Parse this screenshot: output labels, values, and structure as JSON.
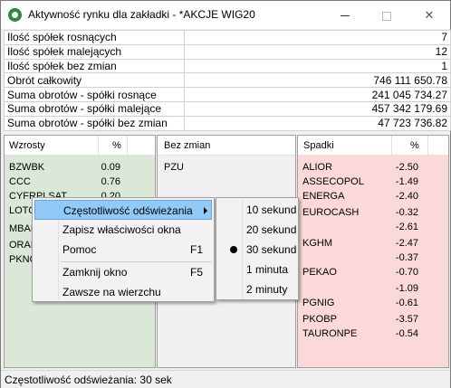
{
  "window": {
    "title": "Aktywność rynku dla zakładki - *AKCJE WIG20",
    "close_glyph": "✕"
  },
  "summary": [
    {
      "label": "Ilość spółek rosnących",
      "value": "7"
    },
    {
      "label": "Ilość spółek malejących",
      "value": "12"
    },
    {
      "label": "Ilość spółek bez zmian",
      "value": "1"
    },
    {
      "label": "Obrót całkowity",
      "value": "746 111 650.78"
    },
    {
      "label": "Suma obrotów - spółki rosnące",
      "value": "241 045 734.27"
    },
    {
      "label": "Suma obrotów - spółki malejące",
      "value": "457 342 179.69"
    },
    {
      "label": "Suma obrotów - spółki bez zmian",
      "value": "47 723 736.82"
    }
  ],
  "panels": {
    "up": {
      "title": "Wzrosty",
      "pct_header": "%",
      "rows": [
        {
          "name": "BZWBK",
          "pct": "0.09"
        },
        {
          "name": "CCC",
          "pct": "0.76"
        },
        {
          "name": "CYFRPLSAT",
          "pct": "0.20"
        },
        {
          "name": "LOTO",
          "pct": ""
        },
        {
          "name": "MBAN",
          "pct": ""
        },
        {
          "name": "ORAN",
          "pct": ""
        },
        {
          "name": "PKNO",
          "pct": ""
        }
      ]
    },
    "none": {
      "title": "Bez zmian",
      "rows": [
        {
          "name": "PZU"
        }
      ]
    },
    "down": {
      "title": "Spadki",
      "pct_header": "%",
      "rows": [
        {
          "name": "ALIOR",
          "pct": "-2.50"
        },
        {
          "name": "ASSECOPOL",
          "pct": "-1.49"
        },
        {
          "name": "ENERGA",
          "pct": "-2.40"
        },
        {
          "name": "EUROCASH",
          "pct": "-0.32"
        },
        {
          "name": "",
          "pct": "-2.61"
        },
        {
          "name": "KGHM",
          "pct": "-2.47"
        },
        {
          "name": "",
          "pct": "-0.37"
        },
        {
          "name": "PEKAO",
          "pct": "-0.70"
        },
        {
          "name": "",
          "pct": "-1.09"
        },
        {
          "name": "PGNIG",
          "pct": "-0.61"
        },
        {
          "name": "PKOBP",
          "pct": "-3.57"
        },
        {
          "name": "TAURONPE",
          "pct": "-0.54"
        }
      ]
    }
  },
  "context_menu": {
    "items": [
      {
        "label": "Częstotliwość odświeżania",
        "shortcut": "",
        "has_submenu": true
      },
      {
        "label": "Zapisz właściwości okna",
        "shortcut": ""
      },
      {
        "label": "Pomoc",
        "shortcut": "F1"
      },
      {
        "label": "Zamknij okno",
        "shortcut": "F5"
      },
      {
        "label": "Zawsze na wierzchu",
        "shortcut": ""
      }
    ]
  },
  "submenu": {
    "items": [
      {
        "label": "10 sekund"
      },
      {
        "label": "20 sekund"
      },
      {
        "label": "30 sekund",
        "selected": true
      },
      {
        "label": "1 minuta"
      },
      {
        "label": "2 minuty"
      }
    ]
  },
  "status": "Częstotliwość odświeżania: 30 sek",
  "colors": {
    "up_panel": "#dbe8d8",
    "down_panel": "#fcd9d9",
    "menu_highlight": "#91c9f7",
    "app_icon": "#2c8a3a"
  }
}
